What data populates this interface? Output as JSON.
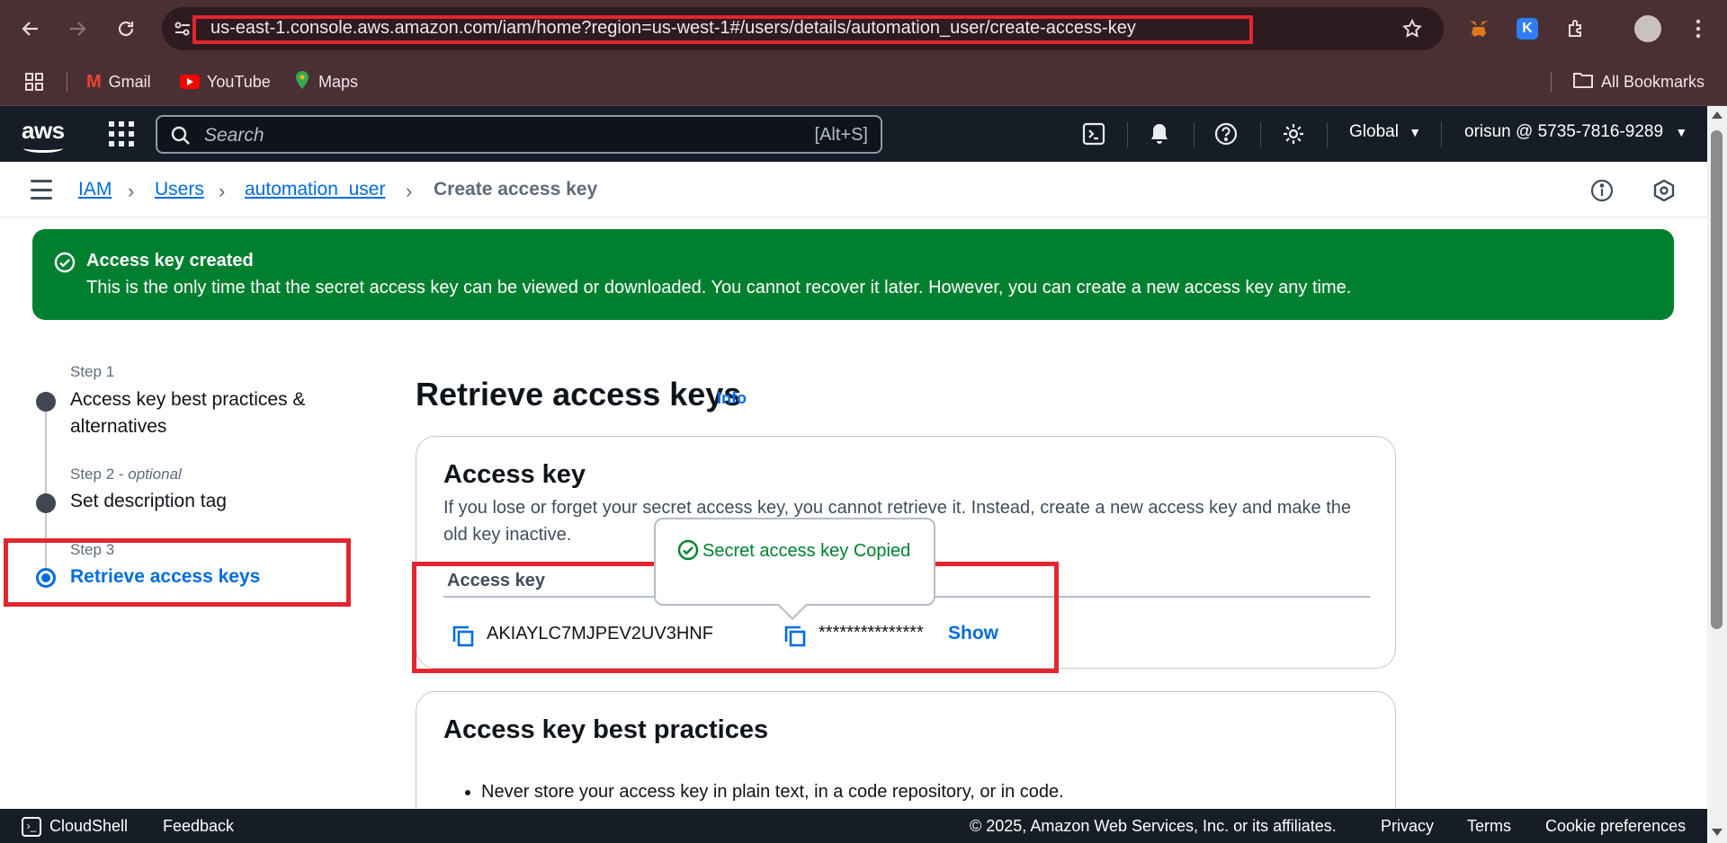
{
  "browser": {
    "url": "us-east-1.console.aws.amazon.com/iam/home?region=us-west-1#/users/details/automation_user/create-access-key",
    "bookmarks": [
      {
        "label": "Gmail",
        "color": "#ea4335"
      },
      {
        "label": "YouTube",
        "color": "#ff0000"
      },
      {
        "label": "Maps",
        "color": "#34a853"
      }
    ],
    "all_bookmarks": "All Bookmarks"
  },
  "aws_header": {
    "logo": "aws",
    "search_placeholder": "Search",
    "search_shortcut": "[Alt+S]",
    "region": "Global",
    "account": "orisun @ 5735-7816-9289"
  },
  "breadcrumbs": {
    "items": [
      "IAM",
      "Users",
      "automation_user"
    ],
    "current": "Create access key"
  },
  "flash": {
    "title": "Access key created",
    "message": "This is the only time that the secret access key can be viewed or downloaded. You cannot recover it later. However, you can create a new access key any time.",
    "color": "#00802f"
  },
  "steps": [
    {
      "label": "Step 1",
      "title": "Access key best practices & alternatives",
      "optional": ""
    },
    {
      "label": "Step 2 - ",
      "optional": "optional",
      "title": "Set description tag"
    },
    {
      "label": "Step 3",
      "title": "Retrieve access keys",
      "optional": ""
    }
  ],
  "main": {
    "title": "Retrieve access keys",
    "info": "Info",
    "access_key_card": {
      "heading": "Access key",
      "description": "If you lose or forget your secret access key, you cannot retrieve it. Instead, create a new access key and make the old key inactive.",
      "column_header": "Access key",
      "access_key_id": "AKIAYLC7MJPEV2UV3HNF",
      "secret_masked": "***************",
      "show_label": "Show"
    },
    "popover": "Secret access key Copied",
    "best_practices_card": {
      "heading": "Access key best practices",
      "items": [
        "Never store your access key in plain text, in a code repository, or in code."
      ]
    }
  },
  "footer": {
    "cloudshell": "CloudShell",
    "feedback": "Feedback",
    "copyright": "© 2025, Amazon Web Services, Inc. or its affiliates.",
    "privacy": "Privacy",
    "terms": "Terms",
    "cookies": "Cookie preferences"
  },
  "colors": {
    "accent": "#006ce0",
    "success": "#00802f",
    "highlight_box": "#e3262d",
    "chrome": "#4a2f35",
    "aws_bar": "#161d26"
  }
}
